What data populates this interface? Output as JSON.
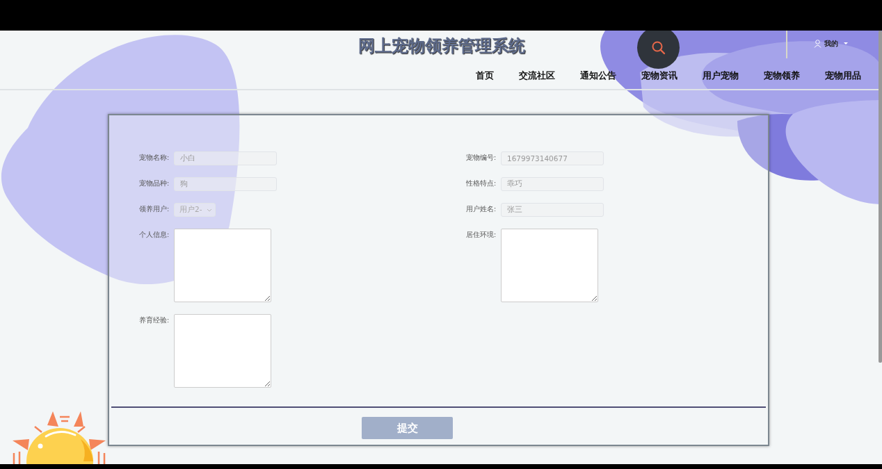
{
  "header": {
    "title": "网上宠物领养管理系统",
    "user_menu": "我的"
  },
  "nav": [
    {
      "label": "首页"
    },
    {
      "label": "交流社区"
    },
    {
      "label": "通知公告"
    },
    {
      "label": "宠物资讯"
    },
    {
      "label": "用户宠物"
    },
    {
      "label": "宠物领养"
    },
    {
      "label": "宠物用品"
    }
  ],
  "form": {
    "fields": [
      {
        "kind": "text",
        "label": "宠物名称:",
        "value": "小白"
      },
      {
        "kind": "text",
        "label": "宠物编号:",
        "value": "1679973140677"
      },
      {
        "kind": "text",
        "label": "宠物品种:",
        "value": "狗"
      },
      {
        "kind": "text",
        "label": "性格特点:",
        "value": "乖巧"
      },
      {
        "kind": "select",
        "label": "领养用户:",
        "value": "用户2-"
      },
      {
        "kind": "text",
        "label": "用户姓名:",
        "value": "张三"
      },
      {
        "kind": "textarea",
        "label": "个人信息:"
      },
      {
        "kind": "textarea",
        "label": "居住环境:"
      },
      {
        "kind": "textarea",
        "label": "养育经验:"
      }
    ],
    "submit": "提交"
  }
}
